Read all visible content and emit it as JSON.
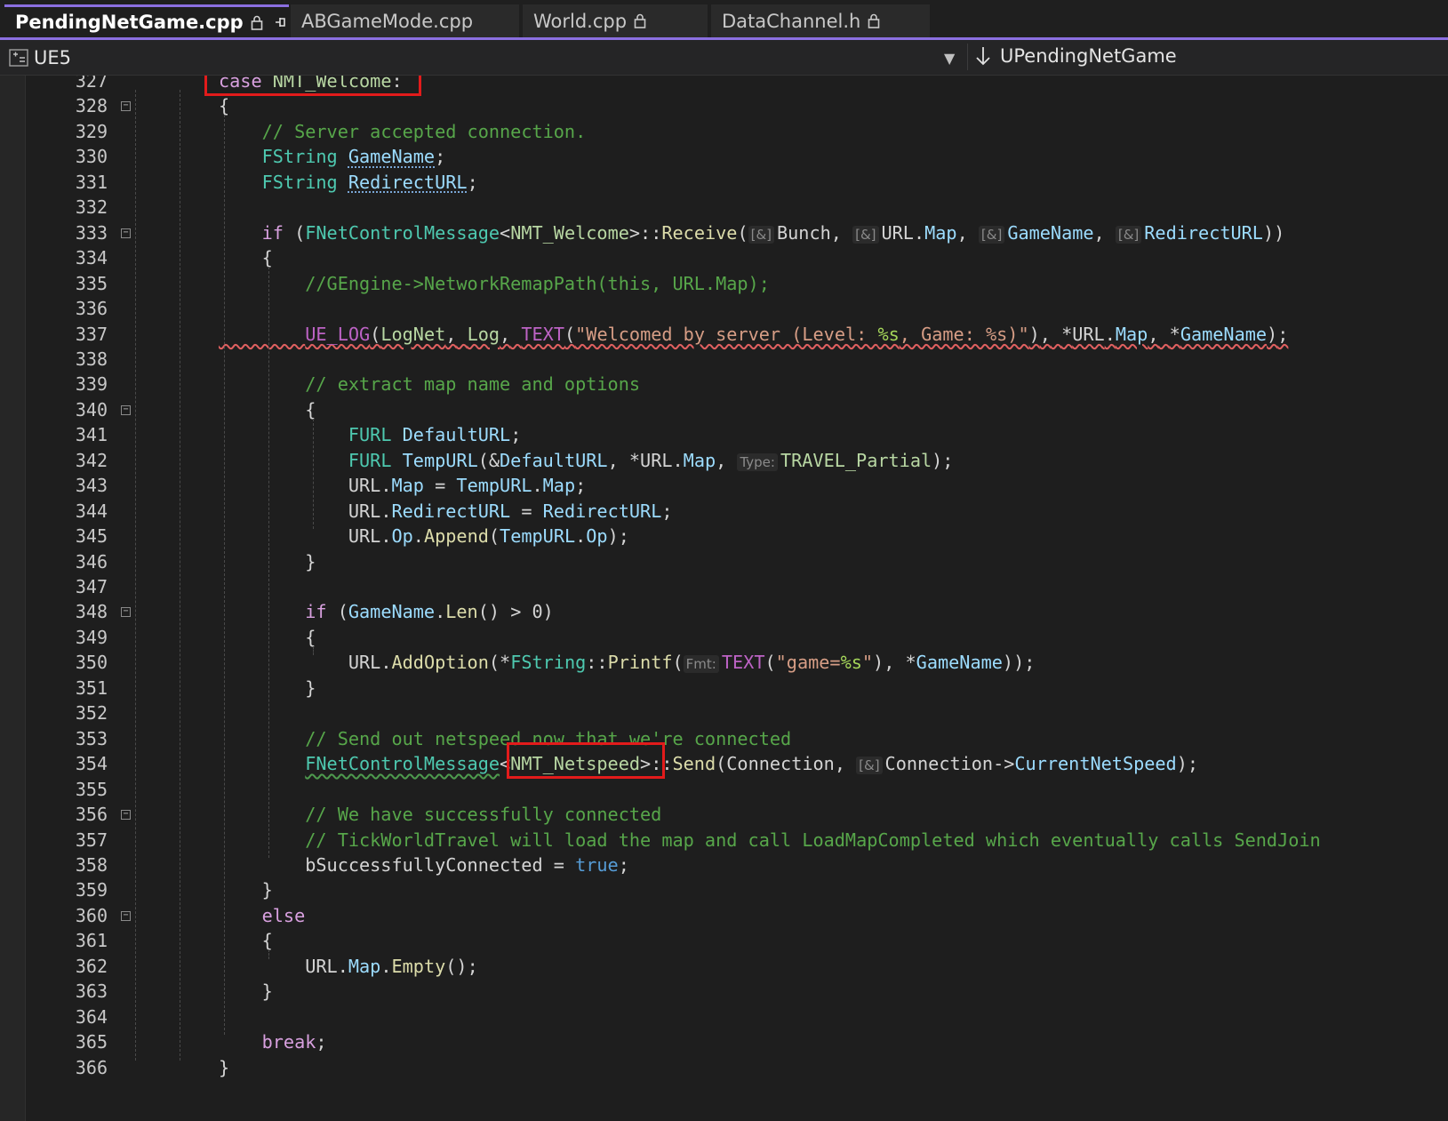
{
  "tabs": [
    {
      "label": "PendingNetGame.cpp",
      "active": true,
      "locked": true,
      "pinned": true,
      "closable": true
    },
    {
      "label": "ABGameMode.cpp",
      "active": false,
      "locked": false
    },
    {
      "label": "World.cpp",
      "active": false,
      "locked": true
    },
    {
      "label": "DataChannel.h",
      "active": false,
      "locked": true
    }
  ],
  "nav": {
    "project": "UE5",
    "scope": "UPendingNetGame"
  },
  "editor": {
    "line_numbers": [
      "327",
      "328",
      "329",
      "330",
      "331",
      "332",
      "333",
      "334",
      "335",
      "336",
      "337",
      "338",
      "339",
      "340",
      "341",
      "342",
      "343",
      "344",
      "345",
      "346",
      "347",
      "348",
      "349",
      "350",
      "351",
      "352",
      "353",
      "354",
      "355",
      "356",
      "357",
      "358",
      "359",
      "360",
      "361",
      "362",
      "363",
      "364",
      "365",
      "366"
    ],
    "lines": [
      "case NMT_Welcome:",
      "{",
      "    // Server accepted connection.",
      "    FString GameName;",
      "    FString RedirectURL;",
      "",
      "    if (FNetControlMessage<NMT_Welcome>::Receive([&]Bunch, [&]URL.Map, [&]GameName, [&]RedirectURL))",
      "    {",
      "        //GEngine->NetworkRemapPath(this, URL.Map);",
      "",
      "        UE_LOG(LogNet, Log, TEXT(\"Welcomed by server (Level: %s, Game: %s)\"), *URL.Map, *GameName);",
      "",
      "        // extract map name and options",
      "        {",
      "            FURL DefaultURL;",
      "            FURL TempURL(&DefaultURL, *URL.Map, Type:TRAVEL_Partial);",
      "            URL.Map = TempURL.Map;",
      "            URL.RedirectURL = RedirectURL;",
      "            URL.Op.Append(TempURL.Op);",
      "        }",
      "",
      "        if (GameName.Len() > 0)",
      "        {",
      "            URL.AddOption(*FString::Printf(Fmt:TEXT(\"game=%s\"), *GameName));",
      "        }",
      "",
      "        // Send out netspeed now that we're connected",
      "        FNetControlMessage<NMT_Netspeed>::Send(Connection, [&]Connection->CurrentNetSpeed);",
      "",
      "        // We have successfully connected",
      "        // TickWorldTravel will load the map and call LoadMapCompleted which eventually calls SendJoin",
      "        bSuccessfullyConnected = true;",
      "    }",
      "    else",
      "    {",
      "        URL.Map.Empty();",
      "    }",
      "",
      "    break;",
      "}"
    ]
  },
  "highlights": [
    "case NMT_Welcome:",
    "NMT_Netspeed"
  ],
  "colors": {
    "accent": "#8b6fe0",
    "highlight_box": "#e21b1b",
    "keyword": "#569cd6",
    "control": "#d8a0df",
    "type": "#4ec9b0",
    "function": "#dcdcaa",
    "string": "#d69d85",
    "comment": "#57a64a",
    "variable": "#9cdcfe"
  }
}
